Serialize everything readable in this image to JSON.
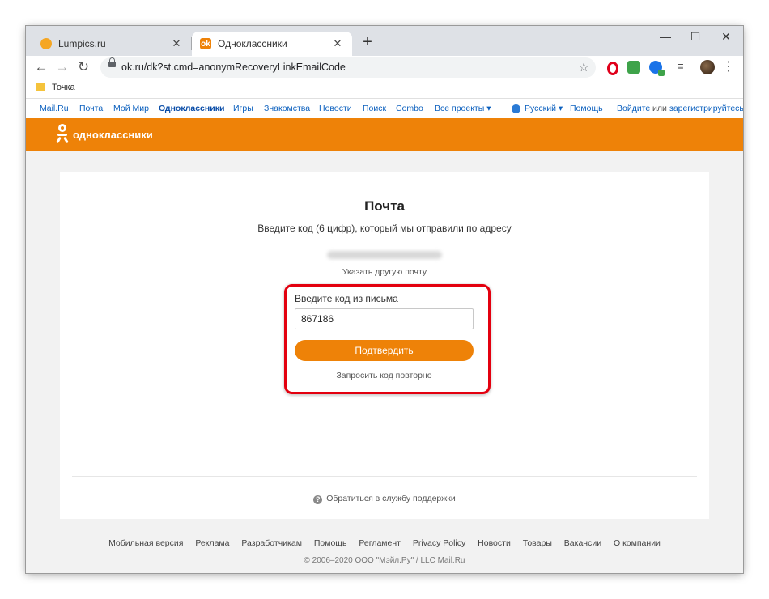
{
  "browser": {
    "tabs": [
      {
        "title": "Lumpics.ru",
        "active": false
      },
      {
        "title": "Одноклассники",
        "active": true
      }
    ],
    "url": "ok.ru/dk?st.cmd=anonymRecoveryLinkEmailCode",
    "bookmark": "Точка",
    "window_controls": [
      "minimize",
      "maximize",
      "close"
    ]
  },
  "portal": {
    "links": [
      "Mail.Ru",
      "Почта",
      "Мой Мир",
      "Одноклассники",
      "Игры",
      "Знакомства",
      "Новости",
      "Поиск",
      "Combo",
      "Все проекты ▾"
    ],
    "language": "Русский ▾",
    "help": "Помощь",
    "login": "Войдите",
    "or": "или",
    "register": "зарегистрируйтесь"
  },
  "brand": {
    "name": "одноклассники",
    "color": "#ee8208"
  },
  "card": {
    "title": "Почта",
    "subtitle": "Введите код (6 цифр), который мы отправили по адресу",
    "other_email_link": "Указать другую почту",
    "code_label": "Введите код из письма",
    "code_value": "867186",
    "confirm_button": "Подтвердить",
    "resend_link": "Запросить код повторно",
    "support_link": "Обратиться в службу поддержки"
  },
  "footer": {
    "links": [
      "Мобильная версия",
      "Реклама",
      "Разработчикам",
      "Помощь",
      "Регламент",
      "Privacy Policy",
      "Новости",
      "Товары",
      "Вакансии",
      "О компании"
    ],
    "copyright": "© 2006–2020 ООО \"Мэйл.Ру\" / LLC Mail.Ru"
  },
  "highlight_color": "#e3000f"
}
